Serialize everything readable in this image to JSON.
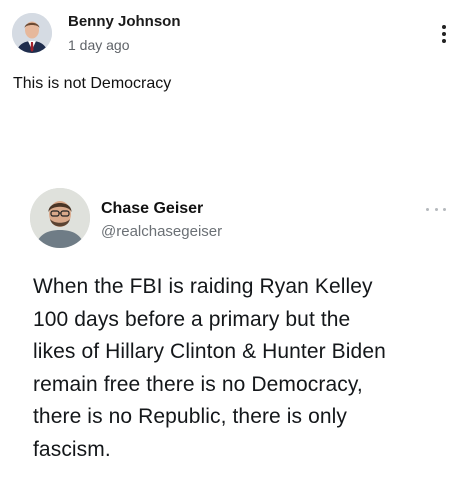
{
  "post": {
    "author": "Benny Johnson",
    "time": "1 day ago",
    "text": "This is not Democracy",
    "avatar_icon": "person-avatar-icon",
    "more_icon": "vertical-ellipsis-icon"
  },
  "tweet": {
    "name": "Chase Geiser",
    "handle": "@realchasegeiser",
    "avatar_icon": "person-avatar-icon",
    "more_icon": "horizontal-ellipsis-icon",
    "lines": [
      "When the FBI is raiding Ryan Kelley",
      "100 days before a primary but the",
      "likes of Hillary Clinton & Hunter Biden",
      "remain free there is no Democracy,",
      "there is no Republic, there is only",
      "fascism."
    ]
  },
  "colors": {
    "text": "#1a1a1a",
    "muted": "#5f6368",
    "handle": "#6b7075",
    "tweet_dots": "#b5b9bd"
  }
}
